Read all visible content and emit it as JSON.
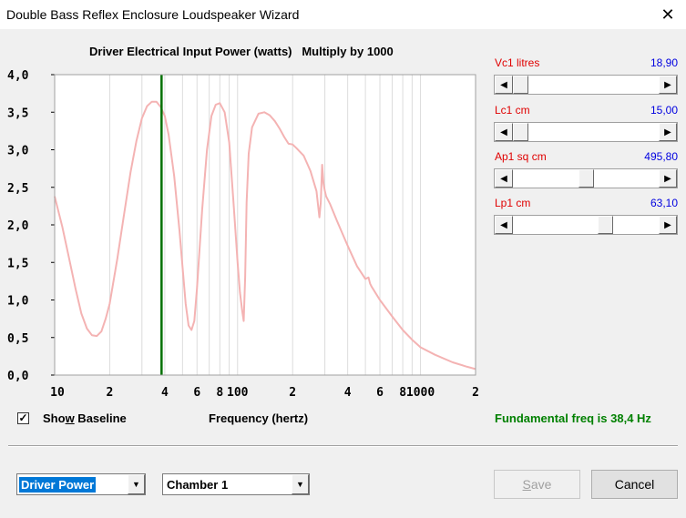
{
  "window": {
    "title": "Double Bass Reflex Enclosure Loudspeaker Wizard",
    "close_glyph": "✕"
  },
  "chart": {
    "title": "Driver Electrical Input Power (watts)   Multiply by 1000"
  },
  "chart_data": {
    "type": "line",
    "title": "Driver Electrical Input Power (watts)   Multiply by 1000",
    "xlabel": "Frequency (hertz)",
    "ylabel": "",
    "x_scale": "log",
    "xlim": [
      10,
      2000
    ],
    "ylim": [
      0,
      4
    ],
    "y_tick_labels": [
      "4,0",
      "3,5",
      "3,0",
      "2,5",
      "2,0",
      "1,5",
      "1,0",
      "0,5",
      "0,0"
    ],
    "x_tick_labels": [
      "10",
      "2",
      "4",
      "6",
      "8",
      "100",
      "2",
      "4",
      "6",
      "8",
      "1000",
      "2"
    ],
    "marker_x": 38.4,
    "series": [
      {
        "color": "#f4b3b3",
        "x": [
          10,
          11,
          12,
          13,
          14,
          15,
          16,
          17,
          18,
          19,
          20,
          22,
          24,
          26,
          28,
          30,
          32,
          34,
          36,
          38,
          40,
          42,
          45,
          48,
          50,
          52,
          54,
          56,
          58,
          60,
          64,
          68,
          72,
          76,
          80,
          85,
          90,
          95,
          100,
          103,
          106,
          108,
          110,
          112,
          115,
          120,
          130,
          140,
          150,
          160,
          170,
          180,
          190,
          200,
          210,
          230,
          250,
          270,
          280,
          285,
          290,
          295,
          300,
          305,
          320,
          350,
          400,
          450,
          500,
          520,
          530,
          540,
          600,
          700,
          800,
          900,
          1000,
          1200,
          1500,
          1800,
          2000
        ],
        "y": [
          2.38,
          1.98,
          1.55,
          1.15,
          0.82,
          0.62,
          0.53,
          0.52,
          0.58,
          0.75,
          0.95,
          1.55,
          2.15,
          2.7,
          3.12,
          3.42,
          3.58,
          3.64,
          3.64,
          3.57,
          3.45,
          3.2,
          2.65,
          1.95,
          1.45,
          0.95,
          0.66,
          0.6,
          0.72,
          1.15,
          2.2,
          3.0,
          3.45,
          3.6,
          3.62,
          3.5,
          3.1,
          2.3,
          1.5,
          1.1,
          0.85,
          0.72,
          1.3,
          2.3,
          2.95,
          3.3,
          3.48,
          3.5,
          3.46,
          3.38,
          3.28,
          3.17,
          3.08,
          3.07,
          3.02,
          2.92,
          2.72,
          2.45,
          2.1,
          2.3,
          2.8,
          2.55,
          2.45,
          2.38,
          2.28,
          2.05,
          1.72,
          1.45,
          1.28,
          1.3,
          1.22,
          1.18,
          1.0,
          0.78,
          0.6,
          0.47,
          0.37,
          0.27,
          0.17,
          0.11,
          0.08
        ]
      }
    ]
  },
  "sliders": [
    {
      "label": "Vc1  litres",
      "value": "18,90",
      "position": 0.0
    },
    {
      "label": "Lc1  cm",
      "value": "15,00",
      "position": 0.0
    },
    {
      "label": "Ap1  sq cm",
      "value": "495,80",
      "position": 0.5
    },
    {
      "label": "Lp1  cm",
      "value": "63,10",
      "position": 0.65
    }
  ],
  "show_baseline": {
    "checked": true,
    "label_pre": "Sho",
    "label_accel": "w",
    "label_post": " Baseline"
  },
  "freq_label": "Frequency (hertz)",
  "fundamental": "Fundamental freq is 38,4 Hz",
  "plot_type": {
    "selected": "Driver Power"
  },
  "chamber": {
    "selected": "Chamber 1"
  },
  "buttons": {
    "save_accel": "S",
    "save_rest": "ave",
    "cancel": "Cancel"
  },
  "icons": {
    "left_arrow": "◀",
    "right_arrow": "▶",
    "combo_arrow": "▼",
    "check": "✓"
  }
}
